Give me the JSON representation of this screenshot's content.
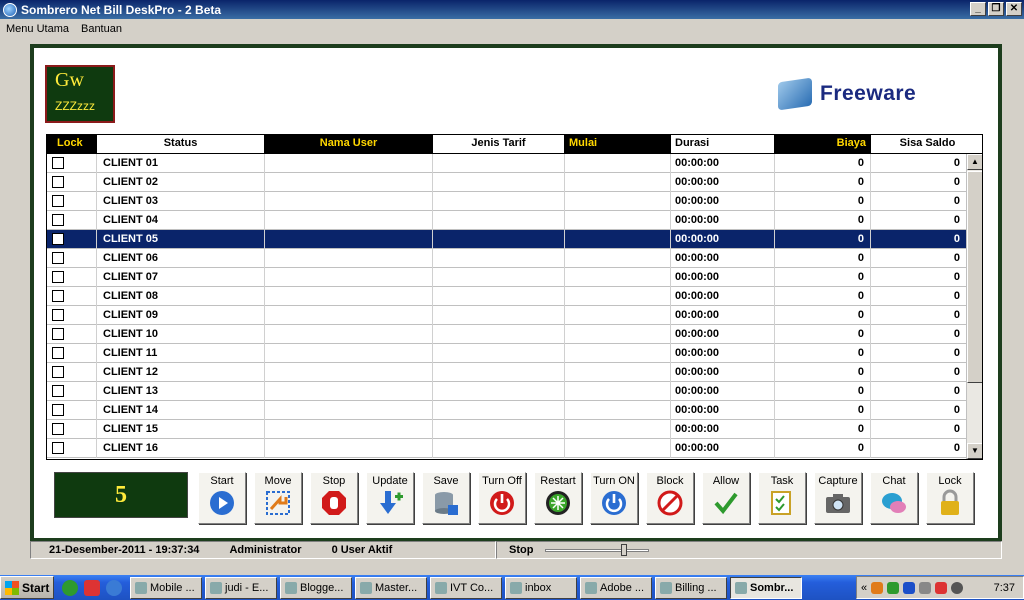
{
  "window": {
    "title": "Sombrero Net Bill DeskPro - 2 Beta",
    "btn_min": "_",
    "btn_max": "❐",
    "btn_close": "✕"
  },
  "menu": [
    "Menu Utama",
    "Bantuan"
  ],
  "logo": {
    "line1": "Gw",
    "line2": "ZZZzzz"
  },
  "brand": "Freeware",
  "grid": {
    "columns": [
      "Lock",
      "Status",
      "Nama User",
      "Jenis Tarif",
      "Mulai",
      "Durasi",
      "Biaya",
      "Sisa Saldo"
    ],
    "rows": [
      {
        "status": "CLIENT 01",
        "durasi": "00:00:00",
        "biaya": "0",
        "saldo": "0"
      },
      {
        "status": "CLIENT 02",
        "durasi": "00:00:00",
        "biaya": "0",
        "saldo": "0"
      },
      {
        "status": "CLIENT 03",
        "durasi": "00:00:00",
        "biaya": "0",
        "saldo": "0"
      },
      {
        "status": "CLIENT 04",
        "durasi": "00:00:00",
        "biaya": "0",
        "saldo": "0"
      },
      {
        "status": "CLIENT 05",
        "durasi": "00:00:00",
        "biaya": "0",
        "saldo": "0",
        "selected": true
      },
      {
        "status": "CLIENT 06",
        "durasi": "00:00:00",
        "biaya": "0",
        "saldo": "0"
      },
      {
        "status": "CLIENT 07",
        "durasi": "00:00:00",
        "biaya": "0",
        "saldo": "0"
      },
      {
        "status": "CLIENT 08",
        "durasi": "00:00:00",
        "biaya": "0",
        "saldo": "0"
      },
      {
        "status": "CLIENT 09",
        "durasi": "00:00:00",
        "biaya": "0",
        "saldo": "0"
      },
      {
        "status": "CLIENT 10",
        "durasi": "00:00:00",
        "biaya": "0",
        "saldo": "0"
      },
      {
        "status": "CLIENT 11",
        "durasi": "00:00:00",
        "biaya": "0",
        "saldo": "0"
      },
      {
        "status": "CLIENT 12",
        "durasi": "00:00:00",
        "biaya": "0",
        "saldo": "0"
      },
      {
        "status": "CLIENT 13",
        "durasi": "00:00:00",
        "biaya": "0",
        "saldo": "0"
      },
      {
        "status": "CLIENT 14",
        "durasi": "00:00:00",
        "biaya": "0",
        "saldo": "0"
      },
      {
        "status": "CLIENT 15",
        "durasi": "00:00:00",
        "biaya": "0",
        "saldo": "0"
      },
      {
        "status": "CLIENT 16",
        "durasi": "00:00:00",
        "biaya": "0",
        "saldo": "0"
      }
    ]
  },
  "counter": "5",
  "toolbar": [
    {
      "label": "Start",
      "icon": "play-icon",
      "color": "#2a6dd1"
    },
    {
      "label": "Move",
      "icon": "move-icon",
      "color": "#e07b1a"
    },
    {
      "label": "Stop",
      "icon": "stop-hand-icon",
      "color": "#d11a1a"
    },
    {
      "label": "Update",
      "icon": "update-icon",
      "color": "#2a6dd1"
    },
    {
      "label": "Save",
      "icon": "database-save-icon",
      "color": "#8a9aa8"
    },
    {
      "label": "Turn Off",
      "icon": "power-off-icon",
      "color": "#d11a1a"
    },
    {
      "label": "Restart",
      "icon": "restart-icon",
      "color": "#3aa62a"
    },
    {
      "label": "Turn ON",
      "icon": "power-on-icon",
      "color": "#2a6dd1"
    },
    {
      "label": "Block",
      "icon": "block-icon",
      "color": "#d11a1a"
    },
    {
      "label": "Allow",
      "icon": "checkmark-icon",
      "color": "#2e9a2e"
    },
    {
      "label": "Task",
      "icon": "task-icon",
      "color": "#c9a227"
    },
    {
      "label": "Capture",
      "icon": "camera-icon",
      "color": "#666"
    },
    {
      "label": "Chat",
      "icon": "chat-icon",
      "color": "#2a9fd1"
    },
    {
      "label": "Lock",
      "icon": "padlock-icon",
      "color": "#e0b11a"
    }
  ],
  "status": {
    "datetime": "21-Desember-2011  -  19:37:34",
    "user": "Administrator",
    "active": "0 User Aktif",
    "state": "Stop"
  },
  "taskbar": {
    "start": "Start",
    "tasks": [
      "Mobile ...",
      "judi - E...",
      "Blogge...",
      "Master...",
      "IVT Co...",
      "inbox",
      "Adobe ...",
      "Billing ...",
      "Sombr..."
    ],
    "tray_expand": "«",
    "clock": "7:37"
  }
}
